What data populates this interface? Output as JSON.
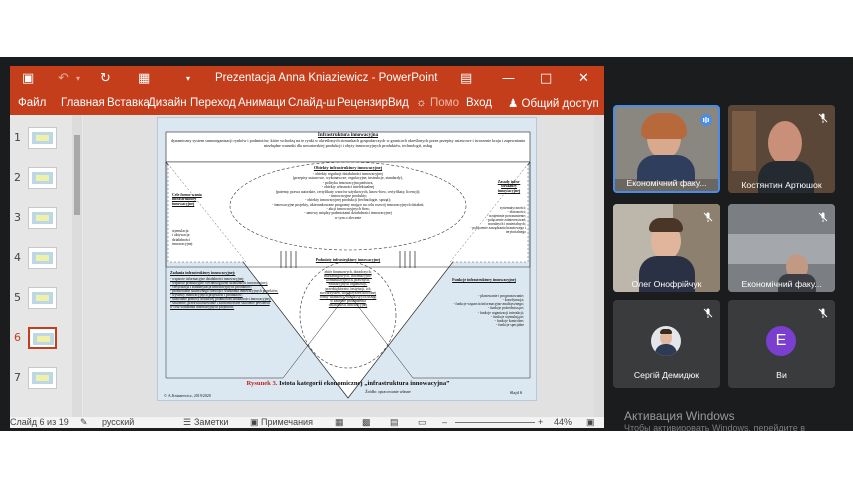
{
  "window": {
    "title": "Prezentacja Anna Kniaziewicz - PowerPoint"
  },
  "ribbon": {
    "tabs": [
      "Файл",
      "Главная",
      "Вставка",
      "Дизайн",
      "Переход",
      "Анимаци",
      "Слайд-ш",
      "Рецензир",
      "Вид"
    ],
    "help_label": "Помо",
    "signin_label": "Вход",
    "share_label": "Общий доступ"
  },
  "thumbnails": {
    "numbers": [
      "1",
      "2",
      "3",
      "4",
      "5",
      "6",
      "7"
    ],
    "active_index": 6
  },
  "slide": {
    "top_title": "Infrastruktura innowacyjna",
    "top_text": "dynamiczny system samoorganizacji rynków i podmiotów, które wchodzą na te rynki w określonych stosunkach gospodarczych w granicach określonych przez przepisy ustawowe i tworzenie kraju i zapewniania niezbędne warunki dla nowatorskiej produkcji i obyty innowacyjnych produktów, technologii, usług",
    "objects_title": "Obiekty infrastruktury innowacyjnej",
    "objects_lines": [
      "- obiekty regulacji działalności innowacyjnej",
      "(przepisy ustawowe, wykonawcze, regulacyjne, instrukcje, standardy),",
      "- polityka innowacyjna państwa,",
      "- obiekty własności intelektualnej",
      "(patenty, prawa autorskie, certyfikaty wzorów użytkowych, know-how, certyfikaty, licencji);",
      "- innowacyjne produkty;",
      "- obiekty innowacyjnej produkcji (technologie, sprzęt);",
      "- innowacyjne projekty, ukierunkowane programy mające na celu rozwój innowacyjnych działań;",
      "- akcji innowacyjnych firm;",
      "- umowy między podmiotami działalności innowacyjnej",
      "w tym o zlecenie"
    ],
    "left_goal_title": "Cele formo-wania infrastruktury innowacyjnej",
    "left_goal_lines": [
      "stymulacja",
      "i aktywacja",
      "działalności",
      "innowacyjnej"
    ],
    "right_rules_title": "Zasady infra-struktury innowacyjnej",
    "right_rules_lines": [
      "systematyczności;",
      "- złożoności;",
      "- wzajemnie porozumienie;",
      "- połączenie zainteresowań;",
      "moralnych i materialnych;",
      "- połączenie zarządzania branżowego i terytorialnego"
    ],
    "subjects_title": "Podmioty infrastruktury innowacyjnej",
    "subjects_lines": [
      "zbiór finansowych, doradczych,",
      "marketingowych, informacyjno-",
      "komunikacyjnych, prawnych,",
      "edukacyjnych organizacji,",
      "przedsiębiorstw, instytucji, ich",
      "stowarzyszeń, stowarzyszeń dowolnej",
      "formy własności, świadczących usługi",
      "w zakresie prowadzenia",
      "działalności innowacyjnej"
    ],
    "tasks_title": "Zadania infrastruktury innowacyjnej:",
    "tasks_lines": [
      "- wsparcie informacyjne działalności innowacyjnej;",
      "- wsparcie produkcyjne i technologiczne działalności innowacyjnej;",
      "- certyfikacja i standaryzacja innowacyjnych produktów;",
      "- promowanie skutecznego rozwoju i wdrażania innowacyjnych projektów;",
      "- wystawy innowacyjnych projektów i produktów;",
      "- udzielanie pomocy doradczej podmiotom działalności innowacyjnej;",
      "- szkolenie, przekwalifikowanie i zaawansowane szkolenie personelu",
      "w celu wdrażania innowacyjnych projektów."
    ],
    "functions_title": "Funkcje infrastruktury innowacyjnej",
    "functions_lines": [
      "- planowanie i prognozowanie;",
      "- koordynacja;",
      "- funkcje wsparcia informacyjno-analitycznego;",
      "- funkcje pośredniczące;",
      "- funkcje organizacji interakcji;",
      "- funkcje stymulujące;",
      "- funkcje kontrolne;",
      "- funkcje specjalne"
    ],
    "caption_prefix": "Rysunek 3.",
    "caption_text": "Istota kategorii ekonomicznej „infrastruktura innowacyjna”",
    "source": "Źródło: opracowanie własne",
    "footer_left": "© A.Kniaziewicz, 2019/2020",
    "footer_right": "Slajd 6"
  },
  "statusbar": {
    "slide_counter": "Слайд 6 из 19",
    "language": "русский",
    "notes_label": "Заметки",
    "comments_label": "Примечания",
    "zoom": "44%"
  },
  "participants": [
    {
      "name": "Економічний факу...",
      "speaking": true,
      "muted": false
    },
    {
      "name": "Костянтин Артюшок",
      "speaking": false,
      "muted": true
    },
    {
      "name": "Олег Онофрійчук",
      "speaking": false,
      "muted": true
    },
    {
      "name": "Економічний факу...",
      "speaking": false,
      "muted": true
    },
    {
      "name": "Сергій Демидюк",
      "speaking": false,
      "muted": true
    },
    {
      "name": "Ви",
      "speaking": false,
      "muted": true,
      "avatar_letter": "E"
    }
  ],
  "os_notice": {
    "title": "Активация Windows",
    "subtitle": "Чтобы активировать Windows, перейдите в"
  },
  "colors": {
    "ppt_accent": "#c43e1c",
    "speaking_border": "#4a8ce8",
    "avatar_purple": "#7b3fd0"
  }
}
